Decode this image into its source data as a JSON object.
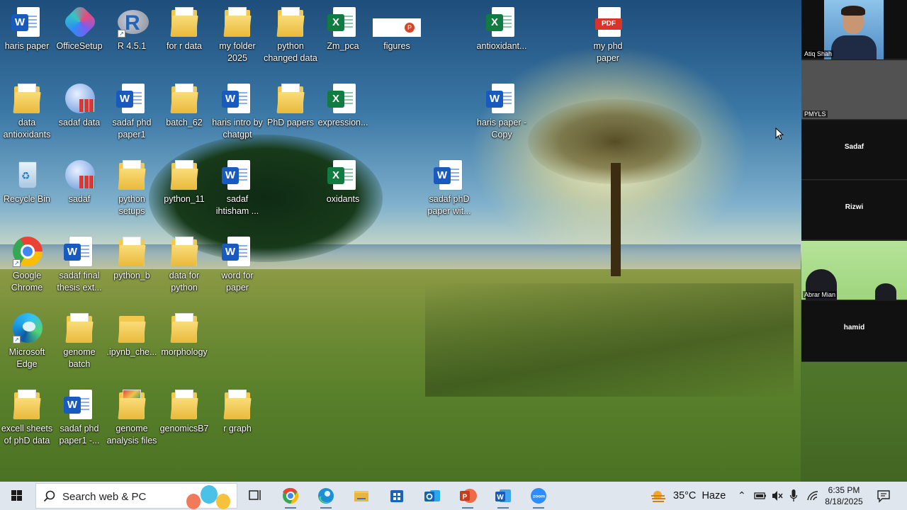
{
  "desktop": {
    "icons": [
      {
        "label": "haris paper",
        "type": "word"
      },
      {
        "label": "OfficeSetup",
        "type": "app"
      },
      {
        "label": "R 4.5.1",
        "type": "app"
      },
      {
        "label": "for r data",
        "type": "folder"
      },
      {
        "label": "my folder 2025",
        "type": "folder"
      },
      {
        "label": "python changed data",
        "type": "folder"
      },
      {
        "label": "Zm_pca",
        "type": "excel"
      },
      {
        "label": "figures",
        "type": "powerpoint"
      },
      {
        "label": "antioxidant...",
        "type": "excel"
      },
      {
        "label": "my phd paper",
        "type": "pdf"
      },
      {
        "label": "data antioxidants",
        "type": "folder"
      },
      {
        "label": "sadaf data",
        "type": "app"
      },
      {
        "label": "sadaf phd paper1",
        "type": "word"
      },
      {
        "label": "batch_62",
        "type": "folder"
      },
      {
        "label": "haris intro by chatgpt",
        "type": "word"
      },
      {
        "label": "PhD papers",
        "type": "folder"
      },
      {
        "label": "expression...",
        "type": "excel"
      },
      {
        "label": "haris paper - Copy",
        "type": "word"
      },
      {
        "label": "Recycle Bin",
        "type": "app"
      },
      {
        "label": "sadaf",
        "type": "app"
      },
      {
        "label": "python setups",
        "type": "folder"
      },
      {
        "label": "python_11",
        "type": "folder"
      },
      {
        "label": "sadaf ihtisham ...",
        "type": "word"
      },
      {
        "label": "oxidants",
        "type": "excel"
      },
      {
        "label": "sadaf phD paper wit...",
        "type": "word"
      },
      {
        "label": "Google Chrome",
        "type": "app"
      },
      {
        "label": "sadaf final thesis ext...",
        "type": "word"
      },
      {
        "label": "python_b",
        "type": "folder"
      },
      {
        "label": "data for python",
        "type": "folder"
      },
      {
        "label": "word for paper",
        "type": "word"
      },
      {
        "label": "Microsoft Edge",
        "type": "app"
      },
      {
        "label": "genome batch",
        "type": "folder"
      },
      {
        "label": ".ipynb_che...",
        "type": "folder"
      },
      {
        "label": "morphology",
        "type": "folder"
      },
      {
        "label": "excell sheets of phD data",
        "type": "folder"
      },
      {
        "label": "sadaf phd paper1 -...",
        "type": "word"
      },
      {
        "label": "genome analysis files",
        "type": "folder"
      },
      {
        "label": "genomicsB7",
        "type": "folder"
      },
      {
        "label": "r graph",
        "type": "folder"
      }
    ]
  },
  "meeting_panel": {
    "participants": [
      "Atiq Shah",
      "PMYLS",
      "Sadaf",
      "Rizwi",
      "Abrar Mian",
      "hamid"
    ]
  },
  "taskbar": {
    "search_placeholder": "Search web & PC",
    "weather": "35°C  Haze",
    "time": "6:35 PM",
    "date": "8/18/2025",
    "apps": [
      "Task View",
      "Google Chrome",
      "Microsoft Edge",
      "File Explorer",
      "Microsoft Store",
      "Outlook",
      "PowerPoint",
      "Word",
      "Zoom"
    ]
  },
  "colors": {
    "word": "#185abd",
    "excel": "#107c41",
    "pdf": "#d9342b",
    "folder": "#f2c94c",
    "taskbar": "#dfe6ee"
  }
}
